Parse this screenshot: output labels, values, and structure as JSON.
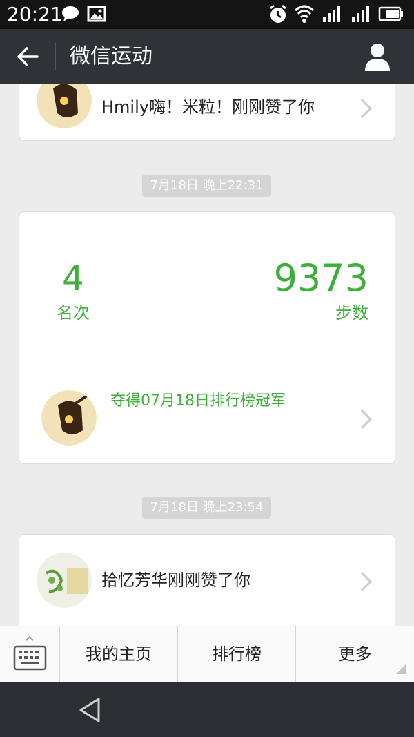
{
  "status_bar": {
    "time": "20:21",
    "icons": [
      "chat-bubble-icon",
      "image-icon",
      "alarm-icon",
      "wifi-icon",
      "signal-icon",
      "signal-icon",
      "battery-icon"
    ]
  },
  "header": {
    "back_icon": "arrow-left-icon",
    "title": "微信运动",
    "profile_icon": "person-icon"
  },
  "feed": {
    "like_card_top": {
      "text": "Hmily嗨！米粒！刚刚赞了你"
    },
    "timestamp_1": "7月18日 晚上22:31",
    "rank_card": {
      "rank": "4",
      "rank_label": "名次",
      "steps": "9373",
      "steps_label": "步数",
      "champion_text": "夺得07月18日排行榜冠军"
    },
    "timestamp_2": "7月18日 晚上23:54",
    "like_card_bottom": {
      "text": "拾忆芳华刚刚赞了你"
    }
  },
  "bottom_menu": {
    "keyboard_icon": "keyboard-icon",
    "items": [
      {
        "label": "我的主页"
      },
      {
        "label": "排行榜"
      },
      {
        "label": "更多"
      }
    ]
  },
  "nav_bar": {
    "back_icon": "triangle-back-icon"
  },
  "colors": {
    "accent_green": "#3cb03a",
    "titlebar": "#2f3236",
    "background": "#ececec"
  }
}
